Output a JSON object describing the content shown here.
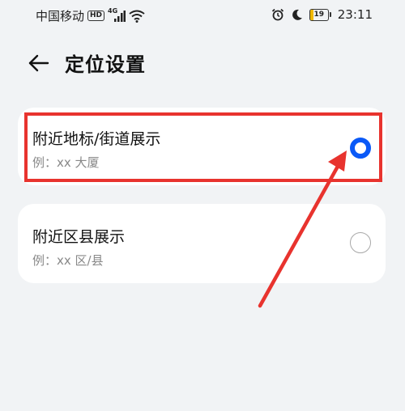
{
  "status_bar": {
    "carrier": "中国移动",
    "hd_badge": "HD",
    "network_type": "4G",
    "battery_level": "19",
    "battery_fraction": 0.19,
    "time": "23:11",
    "icons": [
      "hd-icon",
      "cellular-signal-icon",
      "wifi-icon",
      "alarm-icon",
      "do-not-disturb-moon-icon",
      "battery-icon"
    ]
  },
  "header": {
    "back_icon": "arrow-left-icon",
    "title": "定位设置"
  },
  "options": [
    {
      "title": "附近地标/街道展示",
      "subtitle": "例：xx 大厦",
      "selected": true
    },
    {
      "title": "附近区县展示",
      "subtitle": "例：xx 区/县",
      "selected": false
    }
  ],
  "colors": {
    "background": "#f1f3f5",
    "card": "#ffffff",
    "accent": "#0a59f7",
    "annotation": "#e8332e"
  }
}
